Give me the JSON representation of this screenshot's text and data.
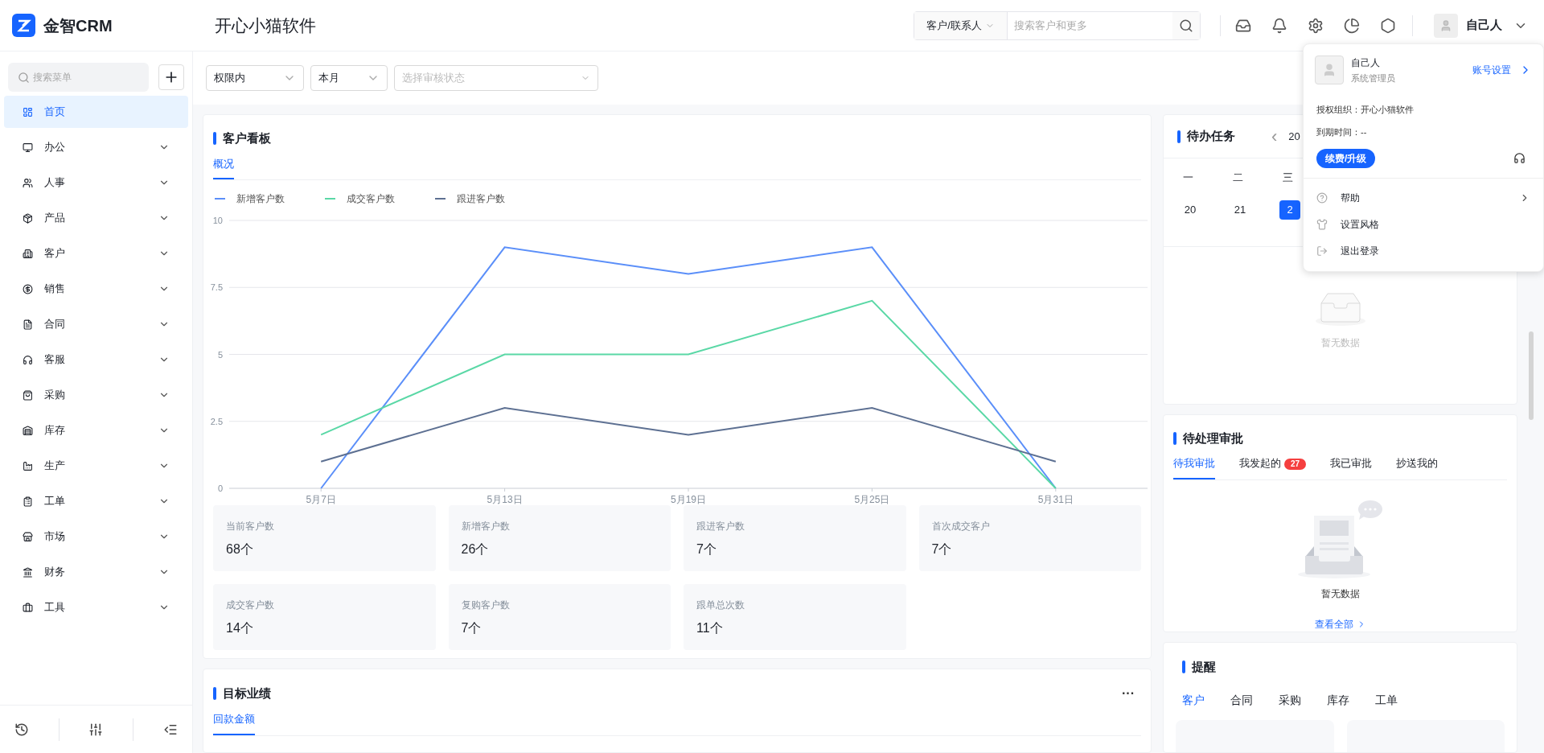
{
  "header": {
    "brand": "金智CRM",
    "org": "开心小猫软件",
    "search_scope": "客户/联系人",
    "search_placeholder": "搜索客户和更多",
    "user": "自己人"
  },
  "sidebar": {
    "search_placeholder": "搜索菜单",
    "items": [
      {
        "label": "首页",
        "selected": true,
        "expandable": false
      },
      {
        "label": "办公",
        "selected": false,
        "expandable": true
      },
      {
        "label": "人事",
        "selected": false,
        "expandable": true
      },
      {
        "label": "产品",
        "selected": false,
        "expandable": true
      },
      {
        "label": "客户",
        "selected": false,
        "expandable": true
      },
      {
        "label": "销售",
        "selected": false,
        "expandable": true
      },
      {
        "label": "合同",
        "selected": false,
        "expandable": true
      },
      {
        "label": "客服",
        "selected": false,
        "expandable": true
      },
      {
        "label": "采购",
        "selected": false,
        "expandable": true
      },
      {
        "label": "库存",
        "selected": false,
        "expandable": true
      },
      {
        "label": "生产",
        "selected": false,
        "expandable": true
      },
      {
        "label": "工单",
        "selected": false,
        "expandable": true
      },
      {
        "label": "市场",
        "selected": false,
        "expandable": true
      },
      {
        "label": "财务",
        "selected": false,
        "expandable": true
      },
      {
        "label": "工具",
        "selected": false,
        "expandable": true
      }
    ]
  },
  "filters": [
    {
      "value": "权限内"
    },
    {
      "value": "本月"
    },
    {
      "placeholder": "选择审核状态"
    }
  ],
  "customer_board": {
    "title": "客户看板",
    "tabs": [
      {
        "label": "概况",
        "selected": true
      }
    ],
    "chart_data": {
      "type": "line",
      "grid": true,
      "categories": [
        "5月7日",
        "5月13日",
        "5月19日",
        "5月25日",
        "5月31日"
      ],
      "yticks": [
        0,
        2.5,
        5,
        7.5,
        10
      ],
      "ylim": [
        0,
        10
      ],
      "series": [
        {
          "name": "新增客户数",
          "color": "#5b8ff9",
          "values": [
            0,
            9,
            8,
            9,
            0
          ]
        },
        {
          "name": "成交客户数",
          "color": "#5ad8a6",
          "values": [
            2,
            5,
            5,
            7,
            0
          ]
        },
        {
          "name": "跟进客户数",
          "color": "#5d7092",
          "values": [
            1,
            3,
            2,
            3,
            1
          ]
        }
      ]
    },
    "stats": [
      {
        "label": "当前客户数",
        "value": "68个"
      },
      {
        "label": "新增客户数",
        "value": "26个"
      },
      {
        "label": "跟进客户数",
        "value": "7个"
      },
      {
        "label": "首次成交客户",
        "value": "7个"
      },
      {
        "label": "成交客户数",
        "value": "14个"
      },
      {
        "label": "复购客户数",
        "value": "7个"
      },
      {
        "label": "跟单总次数",
        "value": "11个"
      }
    ]
  },
  "target": {
    "title": "目标业绩",
    "more": "···",
    "tabs": [
      {
        "label": "回款金额",
        "selected": true
      }
    ]
  },
  "tasks": {
    "title": "待办任务",
    "prev": "‹",
    "period": "20",
    "weekdays": [
      "一",
      "二",
      "三"
    ],
    "days": [
      {
        "label": "20",
        "selected": false
      },
      {
        "label": "21",
        "selected": false
      },
      {
        "label": "2",
        "selected": true
      }
    ],
    "empty": "暂无数据"
  },
  "approvals": {
    "title": "待处理审批",
    "tabs": [
      {
        "label": "待我审批",
        "selected": true
      },
      {
        "label": "我发起的",
        "selected": false,
        "badge": "27"
      },
      {
        "label": "我已审批",
        "selected": false
      },
      {
        "label": "抄送我的",
        "selected": false
      }
    ],
    "empty": "暂无数据",
    "view_all": "查看全部"
  },
  "reminders": {
    "title": "提醒",
    "tabs": [
      {
        "label": "客户",
        "selected": true
      },
      {
        "label": "合同",
        "selected": false
      },
      {
        "label": "采购",
        "selected": false
      },
      {
        "label": "库存",
        "selected": false
      },
      {
        "label": "工单",
        "selected": false
      }
    ]
  },
  "user_menu": {
    "name": "自己人",
    "role": "系统管理员",
    "account_link": "账号设置",
    "org": "授权组织：开心小猫软件",
    "expiry": "到期时间：--",
    "upgrade": "续费/升级",
    "items": [
      {
        "label": "帮助",
        "submenu": true
      },
      {
        "label": "设置风格",
        "submenu": false
      },
      {
        "label": "退出登录",
        "submenu": false
      }
    ]
  }
}
